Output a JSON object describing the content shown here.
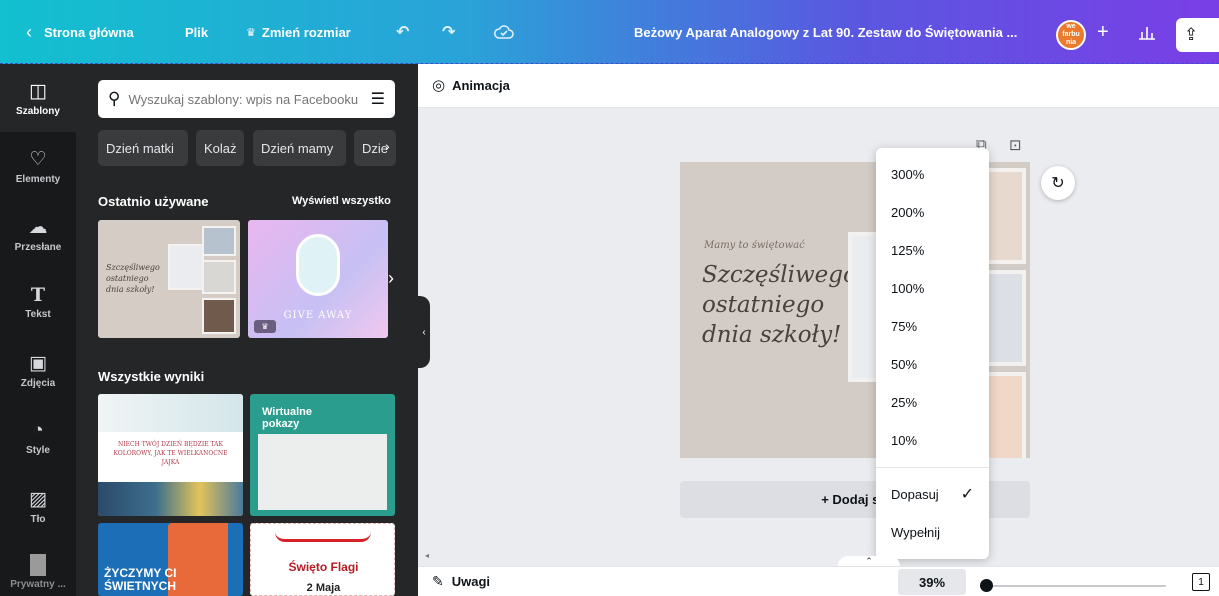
{
  "topbar": {
    "back_label": "Strona główna",
    "file_label": "Plik",
    "resize_label": "Zmień rozmiar",
    "title": "Beżowy Aparat Analogowy z Lat 90. Zestaw do Świętowania ...",
    "logo_lines": [
      "we",
      "farbu",
      "nia"
    ]
  },
  "rail": {
    "items": [
      {
        "label": "Szablony",
        "icon": "template-icon"
      },
      {
        "label": "Elementy",
        "icon": "elements-icon"
      },
      {
        "label": "Przesłane",
        "icon": "upload-cloud-icon"
      },
      {
        "label": "Tekst",
        "icon": "text-icon"
      },
      {
        "label": "Zdjęcia",
        "icon": "photo-icon"
      },
      {
        "label": "Style",
        "icon": "palette-icon"
      },
      {
        "label": "Tło",
        "icon": "background-icon"
      },
      {
        "label": "Prywatny ...",
        "icon": "folder-icon"
      }
    ]
  },
  "panel": {
    "search_placeholder": "Wyszukaj szablony: wpis na Facebooku",
    "chips": [
      "Dzień matki",
      "Kolaż",
      "Dzień mamy",
      "Dzie"
    ],
    "recent_title": "Ostatnio używane",
    "see_all": "Wyświetl wszystko",
    "all_results_title": "Wszystkie wyniki",
    "thumb1_lines": [
      "Szczęśliwego",
      "ostatniego",
      "dnia szkoły!"
    ],
    "thumb2_text": "GIVE AWAY",
    "res1_text": "NIECH TWÓJ DZIEŃ BĘDZIE TAK KOLOROWY, JAK TE WIELKANOCNE JAJKA",
    "res2_title": "Wirtualne pokazy",
    "res3_text": "ŻYCZYMY CI ŚWIETNYCH",
    "res4_title": "Święto Flagi",
    "res4_sub": "2 Maja"
  },
  "context_bar": {
    "animation_label": "Animacja"
  },
  "canvas": {
    "small_text": "Mamy to świętować",
    "headline_lines": [
      "Szczęśliwego",
      "ostatniego",
      "dnia szkoły!"
    ],
    "add_page_label": "+ Dodaj str"
  },
  "zoom_menu": {
    "options": [
      "300%",
      "200%",
      "125%",
      "100%",
      "75%",
      "50%",
      "25%",
      "10%"
    ],
    "fit_label": "Dopasuj",
    "fill_label": "Wypełnij",
    "selected": "Dopasuj"
  },
  "bottom": {
    "notes_label": "Uwagi",
    "zoom_value": "39%",
    "zoom_fraction": 0.39,
    "page_count": "1"
  }
}
